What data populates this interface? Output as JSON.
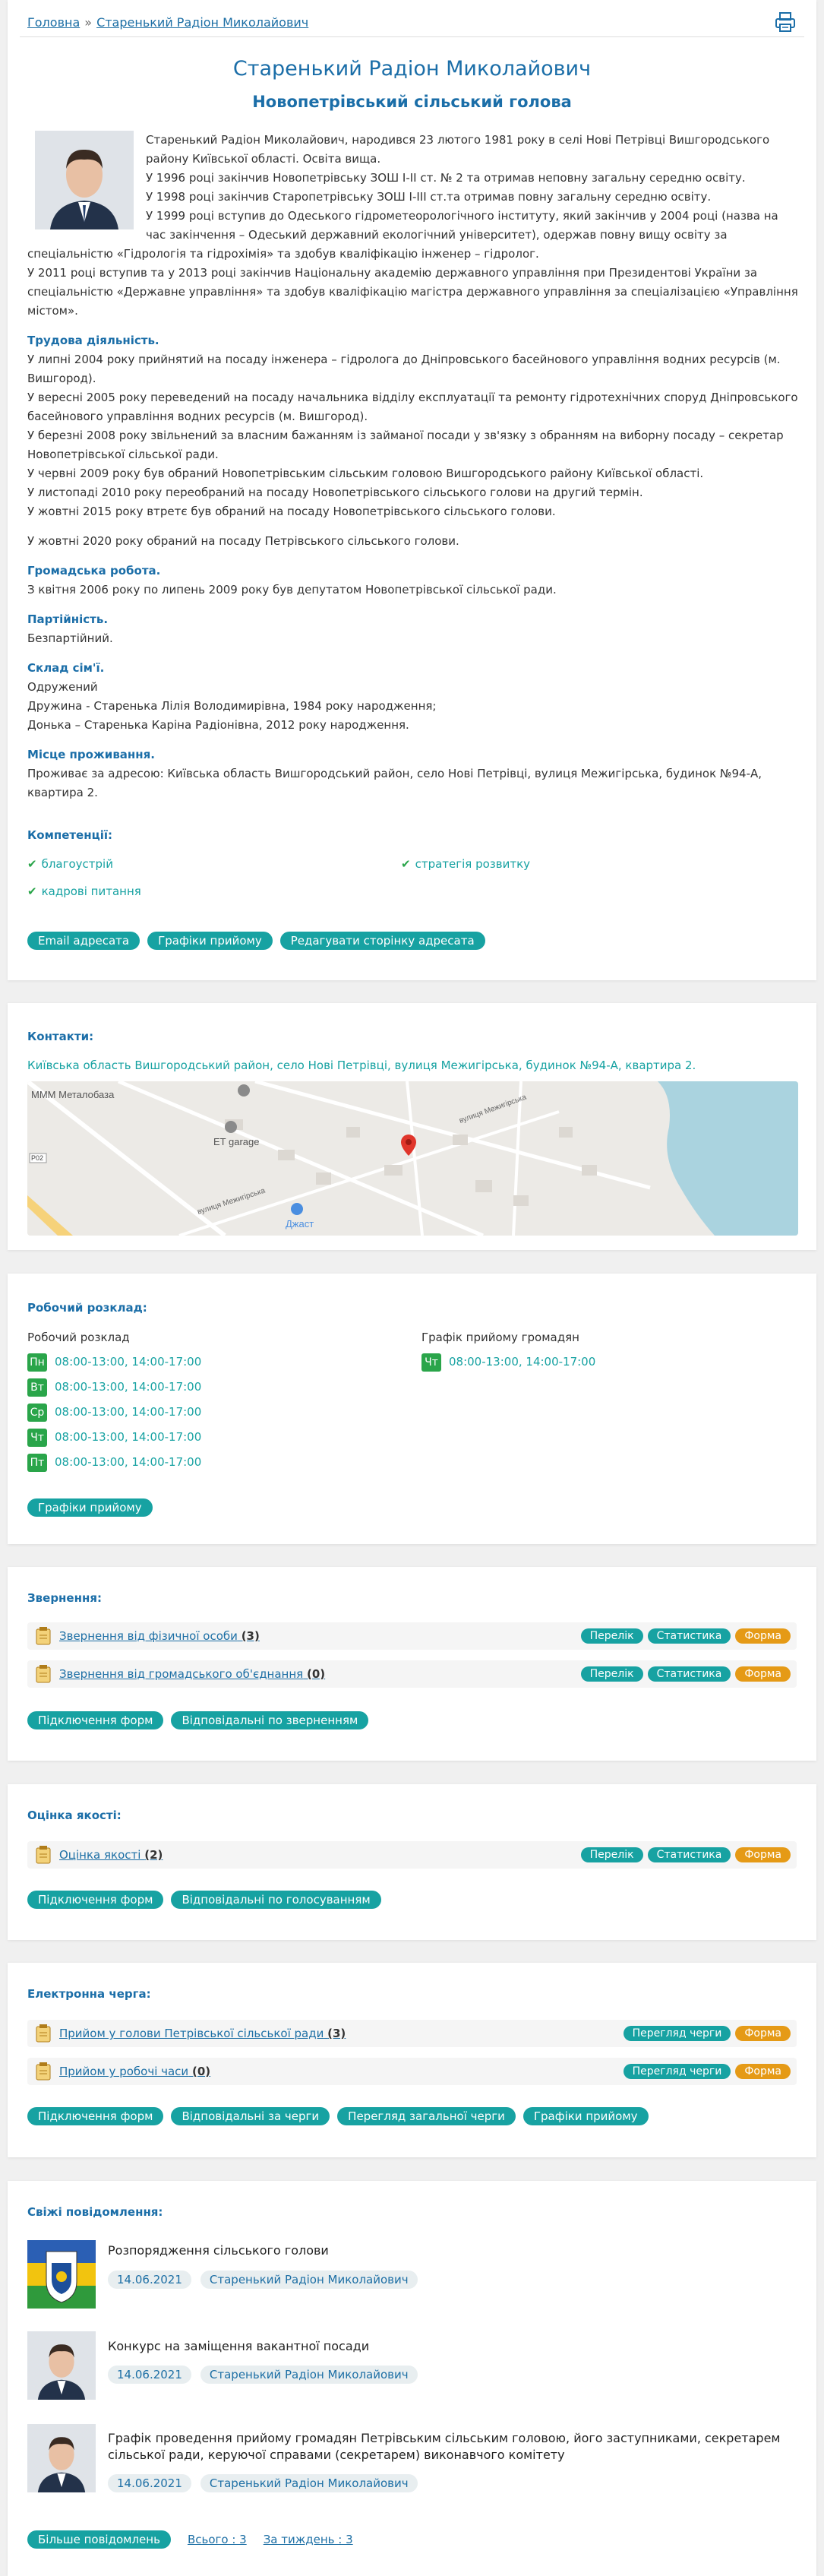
{
  "breadcrumb": {
    "home": "Головна",
    "sep": "»",
    "current": "Старенький Радіон Миколайович"
  },
  "header": {
    "name": "Старенький Радіон Миколайович",
    "position": "Новопетрівський сільський голова"
  },
  "bio": {
    "intro": [
      "Старенький Радіон Миколайович, народився 23 лютого 1981 року в селі Нові Петрівці Вишгородського району Київської області. Освіта вища.",
      "У 1996 році закінчив Новопетрівську ЗОШ І-ІІ ст. № 2 та отримав неповну загальну середню освіту.",
      "У 1998 році закінчив Старопетрівську ЗОШ І-ІІІ ст.та отримав повну загальну середню освіту.",
      "У 1999 році вступив до Одеського гідрометеорологічного інституту, який закінчив у 2004 році (назва на час закінчення – Одеський державний екологічний університет), одержав повну вищу освіту за спеціальністю «Гідрологія та гідрохімія» та здобув кваліфікацію інженер – гідролог.",
      "У 2011 році вступив та у 2013 році закінчив Національну академію державного управління при Президентові України за спеціальністю «Державне управління» та здобув кваліфікацію магістра державного управління за спеціалізацією «Управління містом»."
    ],
    "work_heading": "Трудова діяльність.",
    "work": [
      "У липні 2004 року прийнятий на посаду інженера – гідролога до Дніпровського басейнового управління водних ресурсів (м. Вишгород).",
      "У вересні 2005 року переведений на посаду начальника відділу експлуатації та ремонту гідротехнічних споруд Дніпровського басейнового управління водних ресурсів (м. Вишгород).",
      "У березні 2008 року звільнений за власним бажанням із займаної посади у зв'язку з обранням на виборну посаду – секретар Новопетрівської сільської ради.",
      "У червні 2009 року був обраний Новопетрівським сільським головою Вишгородського району Київської області.",
      "У листопаді 2010 року переобраний на посаду Новопетрівського сільського голови на другий термін.",
      "У жовтні 2015 року втретє був обраний на посаду Новопетрівського сільського голови."
    ],
    "work_extra": "У жовтні 2020 року обраний на посаду Петрівського сільського голови.",
    "public_heading": "Громадська робота.",
    "public": "З квітня 2006 року по липень 2009 року був депутатом Новопетрівської сільської ради.",
    "party_heading": "Партійність.",
    "party": "Безпартійний.",
    "family_heading": "Склад сім'ї.",
    "family": [
      "Одружений",
      "Дружина - Старенька Лілія Володимирівна, 1984 року народження;",
      "Донька – Старенька Каріна Радіонівна, 2012 року народження."
    ],
    "residence_heading": "Місце проживання.",
    "residence": "Проживає за адресою: Київська область Вишгородський район, село Нові Петрівці, вулиця Межигірська, будинок №94-А, квартира 2."
  },
  "competencies": {
    "heading": "Компетенції:",
    "items": [
      "благоустрій",
      "стратегія розвитку",
      "кадрові питання"
    ]
  },
  "profile_buttons": [
    "Email адресата",
    "Графіки прийому",
    "Редагувати сторінку адресата"
  ],
  "contacts": {
    "heading": "Контакти:",
    "address": "Київська область Вишгородський район, село Нові Петрівці, вулиця Межигірська, будинок №94-А, квартира 2.",
    "map_labels": {
      "poi1": "МММ Металобаза",
      "poi2": "ET garage",
      "poi3": "Джаст",
      "street1": "вулиця Межигірська",
      "street2": "вулиця Межигірська",
      "road": "Р02"
    }
  },
  "schedule": {
    "heading": "Робочий розклад:",
    "work_title": "Робочий розклад",
    "days": [
      {
        "d": "Пн",
        "t": "08:00-13:00, 14:00-17:00"
      },
      {
        "d": "Вт",
        "t": "08:00-13:00, 14:00-17:00"
      },
      {
        "d": "Ср",
        "t": "08:00-13:00, 14:00-17:00"
      },
      {
        "d": "Чт",
        "t": "08:00-13:00, 14:00-17:00"
      },
      {
        "d": "Пт",
        "t": "08:00-13:00, 14:00-17:00"
      }
    ],
    "reception_title": "Графік прийому громадян",
    "reception": {
      "d": "Чт",
      "t": "08:00-13:00, 14:00-17:00"
    },
    "button": "Графіки прийому"
  },
  "appeals": {
    "heading": "Звернення:",
    "rows": [
      {
        "label": "Звернення від фізичної особи",
        "count": "(3)"
      },
      {
        "label": "Звернення від громадського об'єднання",
        "count": "(0)"
      }
    ],
    "row_buttons": [
      "Перелік",
      "Статистика",
      "Форма"
    ],
    "buttons": [
      "Підключення форм",
      "Відповідальні по зверненням"
    ]
  },
  "quality": {
    "heading": "Оцінка якості:",
    "rows": [
      {
        "label": "Оцінка якості",
        "count": "(2)"
      }
    ],
    "row_buttons": [
      "Перелік",
      "Статистика",
      "Форма"
    ],
    "buttons": [
      "Підключення форм",
      "Відповідальні по голосуванням"
    ]
  },
  "queue": {
    "heading": "Електронна черга:",
    "rows": [
      {
        "label": "Прийом у голови Петрівської сільської ради",
        "count": "(3)"
      },
      {
        "label": "Прийом у робочі часи",
        "count": "(0)"
      }
    ],
    "row_buttons": [
      "Перегляд черги",
      "Форма"
    ],
    "buttons": [
      "Підключення форм",
      "Відповідальні за черги",
      "Перегляд загальної черги",
      "Графіки прийому"
    ]
  },
  "news": {
    "heading": "Свіжі повідомлення:",
    "items": [
      {
        "title": "Розпорядження сільського голови",
        "date": "14.06.2021",
        "author": "Старенький Радіон Миколайович"
      },
      {
        "title": "Конкурс на заміщення вакантної посади",
        "date": "14.06.2021",
        "author": "Старенький Радіон Миколайович"
      },
      {
        "title": "Графік проведення прийому громадян Петрівським сільським головою, його заступниками, секретарем сільської ради, керуючої справами (секретарем) виконавчого комітету",
        "date": "14.06.2021",
        "author": "Старенький Радіон Миколайович"
      }
    ],
    "more": "Більше повідомлень",
    "total": "Всього : 3",
    "week": "За тиждень : 3"
  },
  "colors": {
    "accent": "#17a2a2",
    "heading": "#1b6ea8",
    "form": "#e59a16",
    "check": "#2aa54a"
  }
}
